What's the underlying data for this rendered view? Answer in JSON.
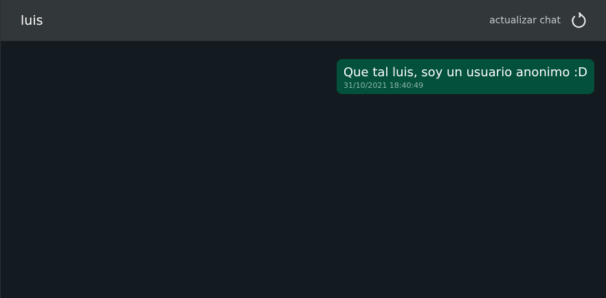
{
  "header": {
    "contact_name": "luis",
    "refresh_label": "actualizar chat",
    "refresh_icon": "refresh-icon"
  },
  "messages": [
    {
      "text": "Que tal luis, soy un usuario anonimo :D",
      "timestamp": "31/10/2021 18:40:49",
      "direction": "outgoing"
    }
  ],
  "colors": {
    "background": "#141b20",
    "header": "#32373a",
    "outgoing_bubble": "#03503d",
    "text": "#ffffff",
    "muted_text": "#c5cbce"
  }
}
